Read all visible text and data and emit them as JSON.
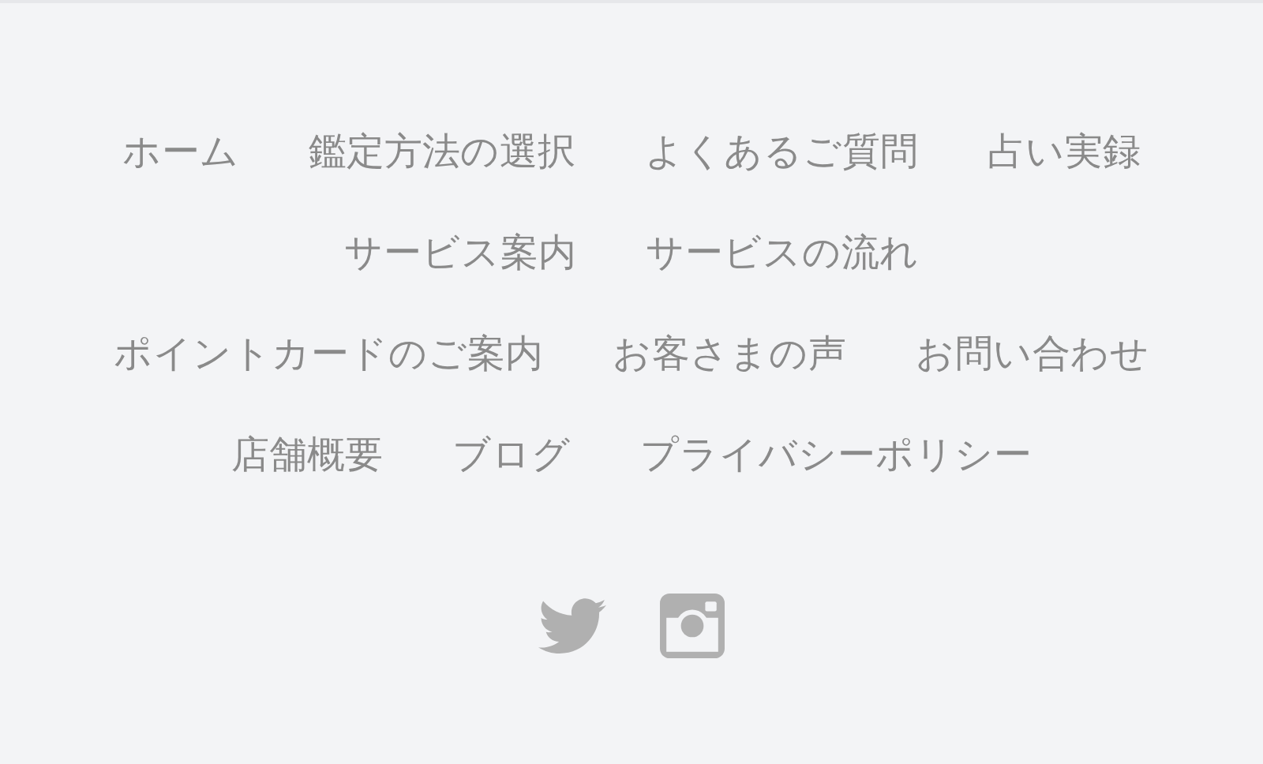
{
  "footer_nav": [
    [
      "ホーム",
      "鑑定方法の選択",
      "よくあるご質問",
      "占い実録"
    ],
    [
      "サービス案内",
      "サービスの流れ"
    ],
    [
      "ポイントカードのご案内",
      "お客さまの声",
      "お問い合わせ"
    ],
    [
      "店舗概要",
      "ブログ",
      "プライバシーポリシー"
    ]
  ],
  "social_links": [
    {
      "kind": "twitter"
    },
    {
      "kind": "instagram"
    }
  ]
}
